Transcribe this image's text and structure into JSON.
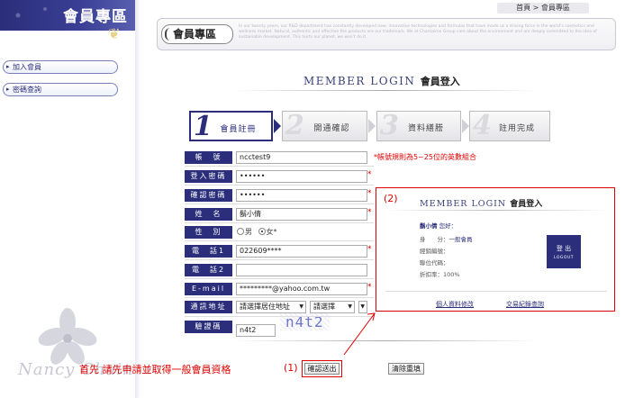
{
  "sidebar": {
    "title": "會員專區",
    "items": [
      {
        "label": "加入會員"
      },
      {
        "label": "密碼查詢"
      }
    ],
    "logo_text": "Nancy Chain"
  },
  "breadcrumb": "首頁 > 會員專區",
  "banner": {
    "badge": "會員專區",
    "text": "In our twenty years, our R&D department has constantly developed new, innovative technologies and formulas that have made us a driving force in the world's cosmetics and wellness market. Natural, authentic and effective the products are our trademark. We at Chantaime Group care about the environment and are deeply committed to the idea of sustainable development. This hurts our planet, we won't do it."
  },
  "login_title": {
    "en": "MEMBER LOGIN",
    "zh": "會員登入"
  },
  "steps": [
    {
      "num": "1",
      "label": "會員註冊"
    },
    {
      "num": "2",
      "label": "開通確認"
    },
    {
      "num": "3",
      "label": "資料繕謄"
    },
    {
      "num": "4",
      "label": "註用完成"
    }
  ],
  "form": {
    "account": {
      "label": "帳　號",
      "value": "ncctest9",
      "hint": "*帳號規則為5~25位的英數組合"
    },
    "password": {
      "label": "登入密碼",
      "value": "••••••"
    },
    "confirm": {
      "label": "確認密碼",
      "value": "••••••"
    },
    "name": {
      "label": "姓　名",
      "value": "鬍小倩"
    },
    "gender": {
      "label": "性　別",
      "male": "男",
      "female": "女*"
    },
    "phone1": {
      "label": "電　話1",
      "value": "022609****"
    },
    "phone2": {
      "label": "電　話2",
      "value": ""
    },
    "email": {
      "label": "E-mail",
      "value": "*********@yahoo.com.tw"
    },
    "address": {
      "label": "通訊地址",
      "city": "請選擇居住地址",
      "district": "請選擇"
    },
    "captcha": {
      "label": "驗證碼",
      "value": "n4t2",
      "image_text": "n4t2"
    },
    "required_mark": "*"
  },
  "buttons": {
    "submit": "確認送出",
    "reset": "清除重填"
  },
  "annotations": {
    "note": "首先 請先申請並取得一般會員資格",
    "n1": "(1)",
    "n2": "(2)"
  },
  "panel": {
    "title_en": "MEMBER LOGIN",
    "title_zh": "會員登入",
    "user": "鬍小倩",
    "greeting": "您好：",
    "rows": [
      {
        "k": "身　　分：",
        "v": "一般會員"
      },
      {
        "k": "經銷編號：",
        "v": ""
      },
      {
        "k": "聯位代碼：",
        "v": ""
      },
      {
        "k": "折扣率：",
        "v": "100%"
      }
    ],
    "logout": "登 出",
    "logout_en": "LOGOUT",
    "link_profile": "個人資料修改",
    "link_orders": "交易紀錄查詢"
  },
  "colors": {
    "brand": "#2b2e7a",
    "alert": "#dd0000"
  }
}
